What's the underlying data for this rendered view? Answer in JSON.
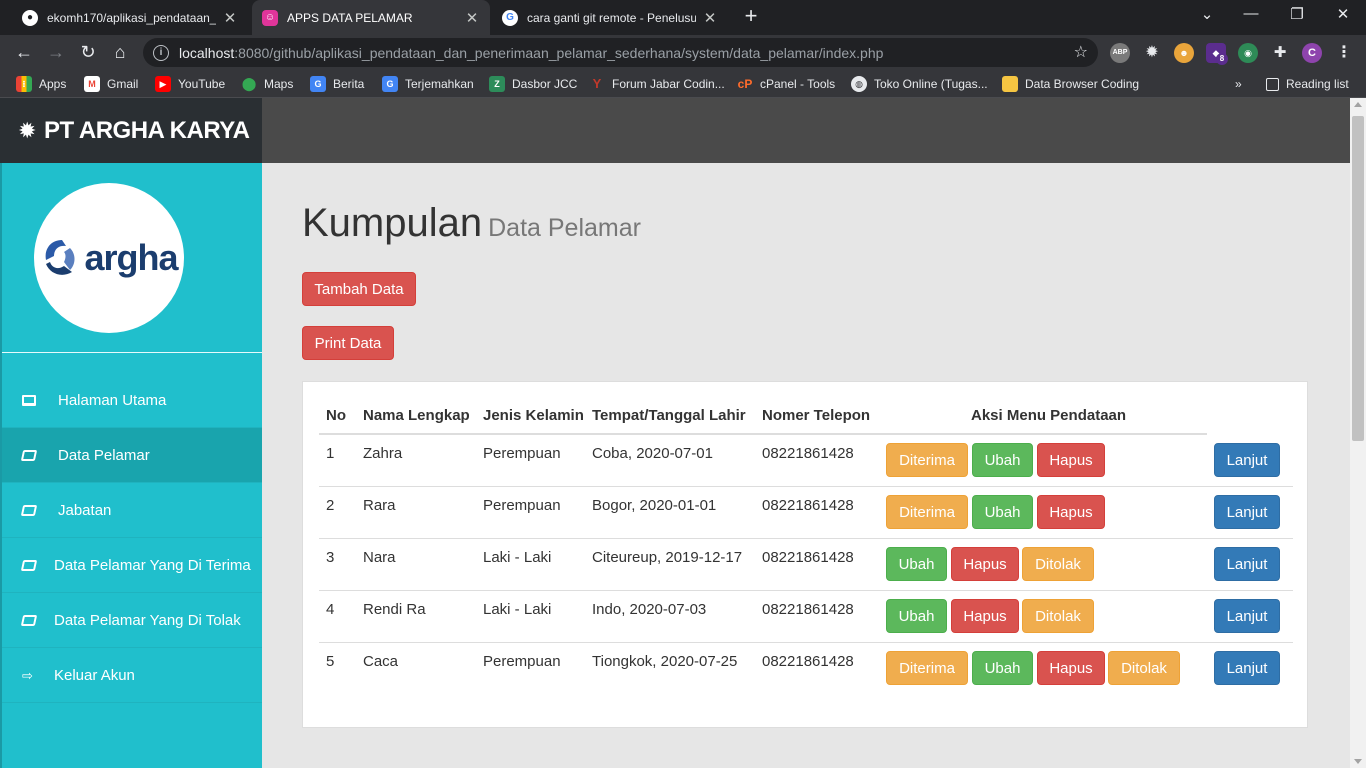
{
  "browser": {
    "tabs": [
      {
        "title": "ekomh170/aplikasi_pendataan_d",
        "favicon": "github-icon"
      },
      {
        "title": "APPS DATA PELAMAR",
        "favicon": "app-icon",
        "active": true
      },
      {
        "title": "cara ganti git remote - Penelusur",
        "favicon": "google-icon"
      }
    ],
    "url_host": "localhost",
    "url_path": ":8080/github/aplikasi_pendataan_dan_penerimaan_pelamar_sederhana/system/data_pelamar/index.php",
    "bookmarks": [
      {
        "label": "Apps",
        "icon": "apps-grid-icon"
      },
      {
        "label": "Gmail",
        "icon": "gmail-icon"
      },
      {
        "label": "YouTube",
        "icon": "youtube-icon"
      },
      {
        "label": "Maps",
        "icon": "maps-icon"
      },
      {
        "label": "Berita",
        "icon": "news-icon"
      },
      {
        "label": "Terjemahkan",
        "icon": "translate-icon"
      },
      {
        "label": "Dasbor JCC",
        "icon": "jcc-icon"
      },
      {
        "label": "Forum Jabar Codin...",
        "icon": "forum-icon"
      },
      {
        "label": "cPanel - Tools",
        "icon": "cpanel-icon"
      },
      {
        "label": "Toko Online (Tugas...",
        "icon": "globe-icon"
      },
      {
        "label": "Data Browser Coding",
        "icon": "folder-icon"
      }
    ],
    "reading_list": "Reading list",
    "ext_badge": "8",
    "profile_initial": "C",
    "abp_label": "ABP"
  },
  "app": {
    "brand": "PT ARGHA KARYA",
    "logo_text": "argha",
    "menu": [
      {
        "label": "Halaman Utama",
        "icon": "monitor-icon"
      },
      {
        "label": "Data Pelamar",
        "icon": "book-icon",
        "active": true
      },
      {
        "label": "Jabatan",
        "icon": "book-icon"
      },
      {
        "label": "Data Pelamar Yang Di Terima",
        "icon": "book-icon"
      },
      {
        "label": "Data Pelamar Yang Di Tolak",
        "icon": "book-icon"
      },
      {
        "label": "Keluar Akun",
        "icon": "sign-out-icon"
      }
    ]
  },
  "page": {
    "title": "Kumpulan",
    "subtitle": "Data Pelamar",
    "add_button": "Tambah Data",
    "print_button": "Print Data"
  },
  "table": {
    "headers": [
      "No",
      "Nama Lengkap",
      "Jenis Kelamin",
      "Tempat/Tanggal Lahir",
      "Nomer Telepon",
      "Aksi Menu Pendataan"
    ],
    "rows": [
      {
        "no": "1",
        "name": "Zahra",
        "gender": "Perempuan",
        "birth": "Coba, 2020-07-01",
        "phone": "08221861428",
        "actions": [
          "Diterima",
          "Ubah",
          "Hapus"
        ]
      },
      {
        "no": "2",
        "name": "Rara",
        "gender": "Perempuan",
        "birth": "Bogor, 2020-01-01",
        "phone": "08221861428",
        "actions": [
          "Diterima",
          "Ubah",
          "Hapus"
        ]
      },
      {
        "no": "3",
        "name": "Nara",
        "gender": "Laki - Laki",
        "birth": "Citeureup, 2019-12-17",
        "phone": "08221861428",
        "actions": [
          "Ubah",
          "Hapus",
          "Ditolak"
        ]
      },
      {
        "no": "4",
        "name": "Rendi Ra",
        "gender": "Laki - Laki",
        "birth": "Indo, 2020-07-03",
        "phone": "08221861428",
        "actions": [
          "Ubah",
          "Hapus",
          "Ditolak"
        ]
      },
      {
        "no": "5",
        "name": "Caca",
        "gender": "Perempuan",
        "birth": "Tiongkok, 2020-07-25",
        "phone": "08221861428",
        "actions": [
          "Diterima",
          "Ubah",
          "Hapus",
          "Ditolak"
        ]
      }
    ],
    "next_label": "Lanjut"
  },
  "colors": {
    "sidebar": "#20bfcc",
    "brand_bar": "#2a2f33",
    "topbar": "#4a4a4a",
    "danger": "#d9534f",
    "warning": "#f0ad4e",
    "success": "#5cb85c",
    "primary": "#337ab7"
  }
}
